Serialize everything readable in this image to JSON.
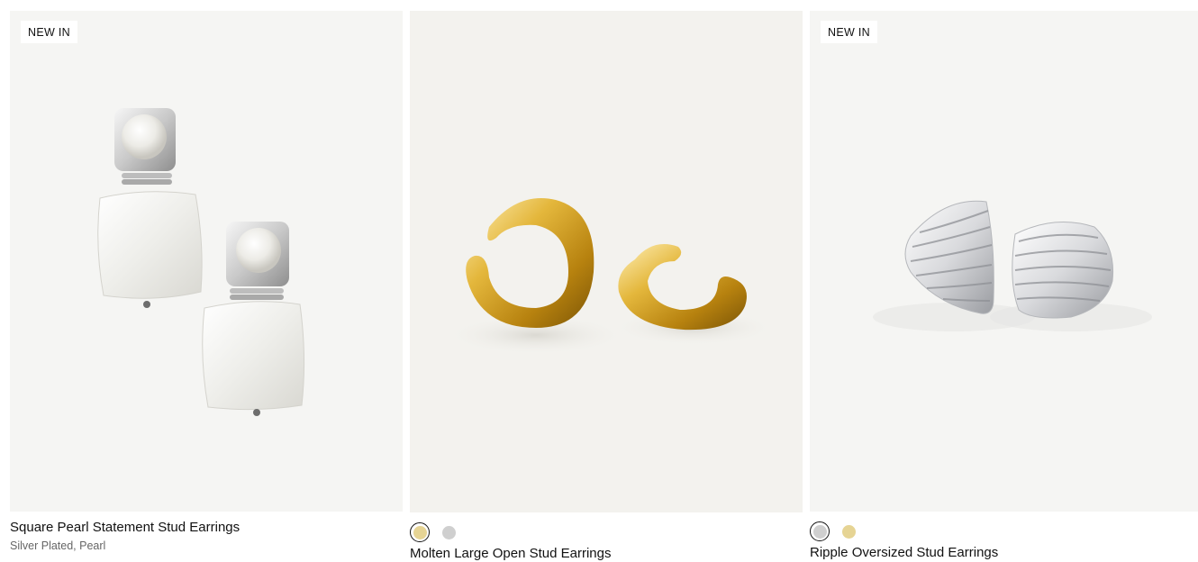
{
  "products": [
    {
      "badge": "NEW IN",
      "title": "Square Pearl Statement Stud Earrings",
      "subtitle": "Silver Plated, Pearl",
      "image": "square-pearl-earrings-image"
    },
    {
      "badge": "",
      "title": "Molten Large Open Stud Earrings",
      "swatches": [
        {
          "name": "gold",
          "color": "#e6d494",
          "selected": true
        },
        {
          "name": "silver",
          "color": "#cfcfcf",
          "selected": false
        }
      ],
      "image": "molten-gold-earrings-image"
    },
    {
      "badge": "NEW IN",
      "title": "Ripple Oversized Stud Earrings",
      "swatches": [
        {
          "name": "silver",
          "color": "#cfcfcf",
          "selected": true
        },
        {
          "name": "gold",
          "color": "#e6d494",
          "selected": false
        }
      ],
      "image": "ripple-silver-earrings-image"
    }
  ]
}
